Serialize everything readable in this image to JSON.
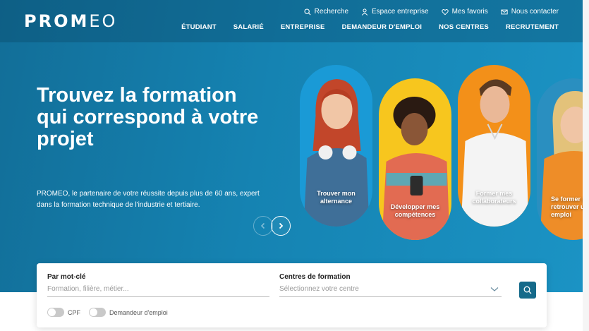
{
  "header": {
    "logo": "PROMEO",
    "utility_links": [
      {
        "label": "Recherche",
        "icon": "search-icon"
      },
      {
        "label": "Espace entreprise",
        "icon": "user-icon"
      },
      {
        "label": "Mes favoris",
        "icon": "heart-icon"
      },
      {
        "label": "Nous contacter",
        "icon": "mail-icon"
      }
    ],
    "main_nav": [
      "ÉTUDIANT",
      "SALARIÉ",
      "ENTREPRISE",
      "DEMANDEUR D'EMPLOI",
      "NOS CENTRES",
      "RECRUTEMENT"
    ]
  },
  "hero": {
    "headline": "Trouvez la formation qui correspond à votre projet",
    "subtext": "PROMEO, le partenaire de votre réussite depuis plus de 60 ans, expert dans la formation technique de l'industrie et tertiaire."
  },
  "carousel": {
    "cards": [
      {
        "label": "Trouver mon alternance",
        "bg": "#1a9ad6"
      },
      {
        "label": "Développer mes compétences",
        "bg": "#f7c61e"
      },
      {
        "label": "Former mes collaborateurs",
        "bg": "#f39019"
      },
      {
        "label": "Se former pour retrouver un emploi",
        "bg": "#2a8fc0"
      }
    ]
  },
  "search": {
    "keyword_label": "Par mot-clé",
    "keyword_placeholder": "Formation, filière, métier...",
    "centres_label": "Centres de formation",
    "centres_placeholder": "Sélectionnez votre centre",
    "toggles": [
      {
        "label": "CPF"
      },
      {
        "label": "Demandeur d'emploi"
      }
    ]
  },
  "colors": {
    "accent": "#156a8a",
    "hero_bg": "#1583b2"
  }
}
